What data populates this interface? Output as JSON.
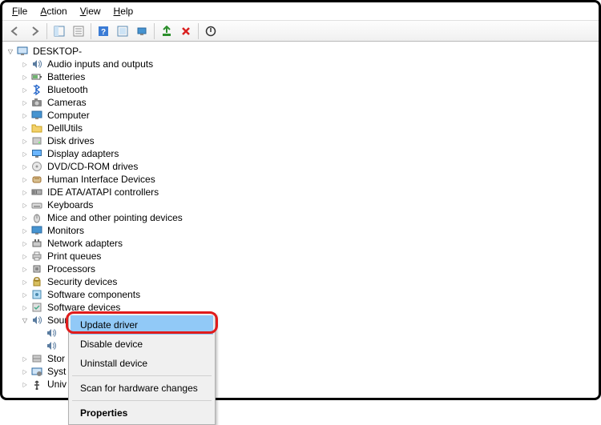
{
  "menubar": {
    "file": "File",
    "action": "Action",
    "view": "View",
    "help": "Help"
  },
  "root": {
    "label": "DESKTOP-"
  },
  "categories": [
    {
      "label": "Audio inputs and outputs",
      "icon": "speaker"
    },
    {
      "label": "Batteries",
      "icon": "battery"
    },
    {
      "label": "Bluetooth",
      "icon": "bluetooth"
    },
    {
      "label": "Cameras",
      "icon": "camera"
    },
    {
      "label": "Computer",
      "icon": "monitor"
    },
    {
      "label": "DellUtils",
      "icon": "folder"
    },
    {
      "label": "Disk drives",
      "icon": "disk"
    },
    {
      "label": "Display adapters",
      "icon": "display"
    },
    {
      "label": "DVD/CD-ROM drives",
      "icon": "optical"
    },
    {
      "label": "Human Interface Devices",
      "icon": "hid"
    },
    {
      "label": "IDE ATA/ATAPI controllers",
      "icon": "ide"
    },
    {
      "label": "Keyboards",
      "icon": "keyboard"
    },
    {
      "label": "Mice and other pointing devices",
      "icon": "mouse"
    },
    {
      "label": "Monitors",
      "icon": "monitor"
    },
    {
      "label": "Network adapters",
      "icon": "network"
    },
    {
      "label": "Print queues",
      "icon": "printer"
    },
    {
      "label": "Processors",
      "icon": "cpu"
    },
    {
      "label": "Security devices",
      "icon": "security"
    },
    {
      "label": "Software components",
      "icon": "component"
    },
    {
      "label": "Software devices",
      "icon": "softdev"
    },
    {
      "label": "Sound, video and game controllers",
      "icon": "speaker",
      "open": true
    }
  ],
  "sound_children": [
    {
      "label": "",
      "icon": "speaker"
    },
    {
      "label": "",
      "icon": "speaker"
    }
  ],
  "tail_categories": [
    {
      "label": "Stor",
      "icon": "storage"
    },
    {
      "label": "Syst",
      "icon": "system"
    },
    {
      "label": "Univ",
      "icon": "usb"
    }
  ],
  "context_menu": {
    "update": "Update driver",
    "disable": "Disable device",
    "uninstall": "Uninstall device",
    "scan": "Scan for hardware changes",
    "properties": "Properties"
  }
}
